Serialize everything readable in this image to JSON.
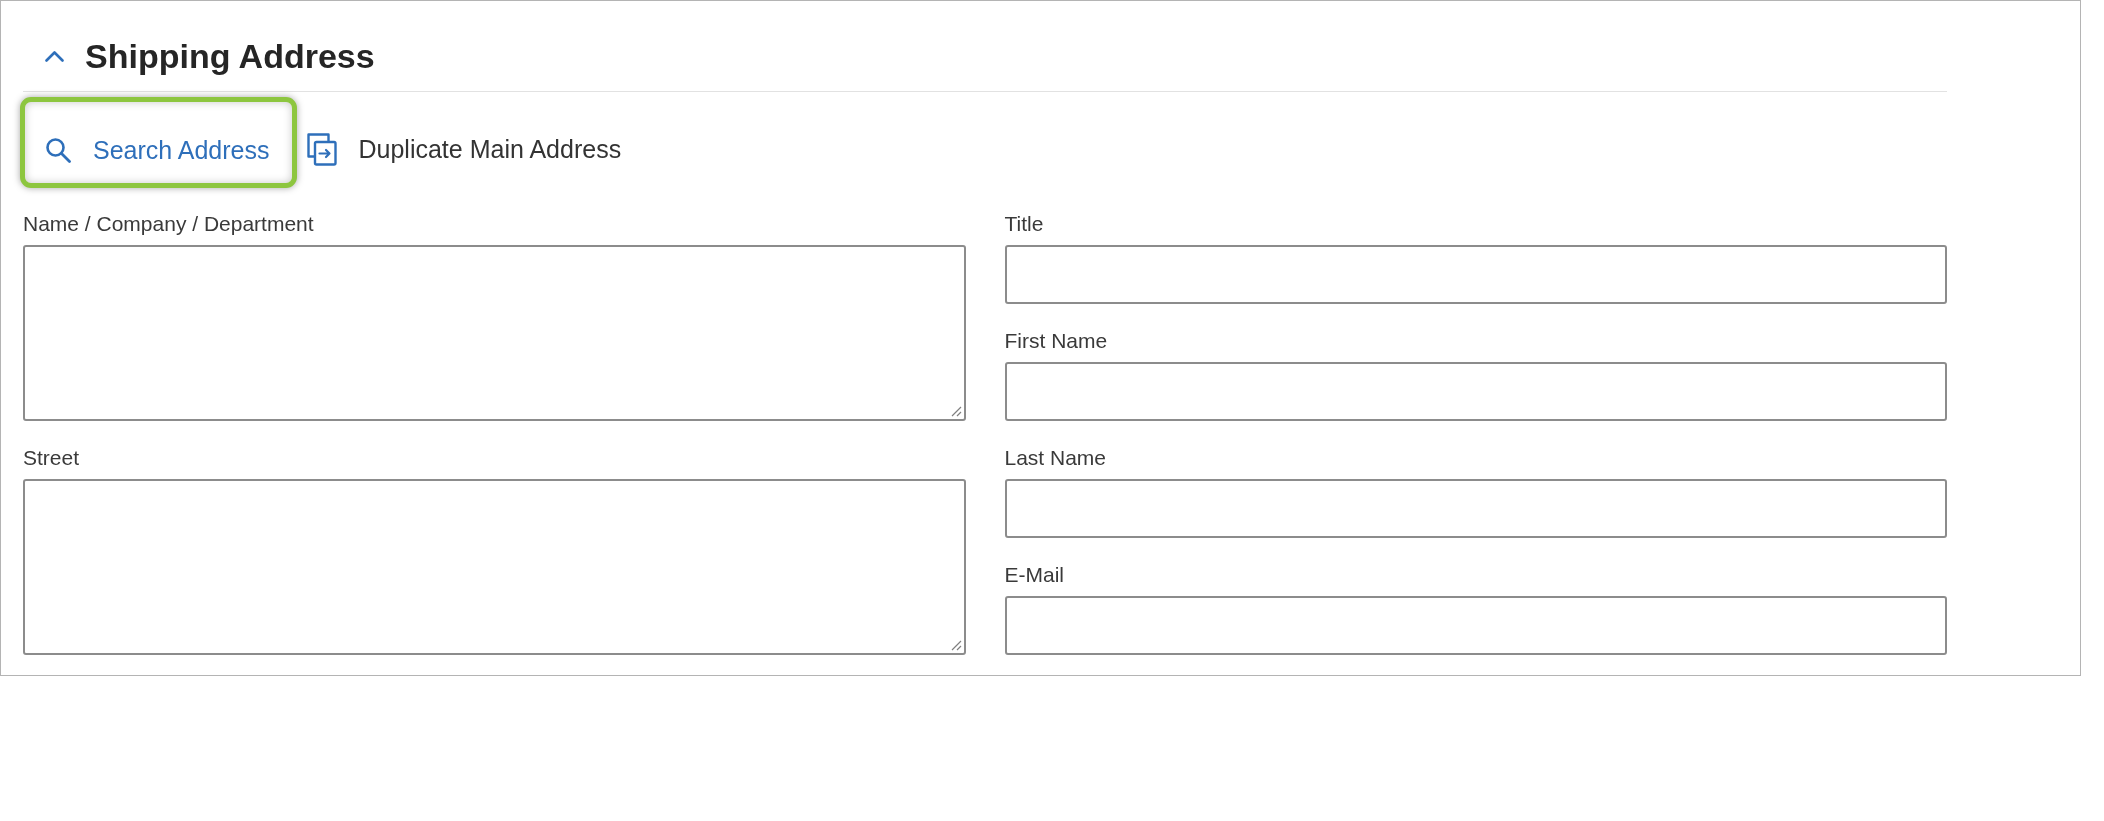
{
  "section": {
    "title": "Shipping Address",
    "expanded": true
  },
  "actions": [
    {
      "label": "Search Address",
      "kind": "search",
      "highlighted": true
    },
    {
      "label": "Duplicate Main Address",
      "kind": "duplicate",
      "highlighted": false
    }
  ],
  "left_fields": [
    {
      "label": "Name / Company / Department",
      "kind": "textarea"
    },
    {
      "label": "Street",
      "kind": "textarea"
    }
  ],
  "right_fields": [
    {
      "label": "Title",
      "kind": "input"
    },
    {
      "label": "First Name",
      "kind": "input"
    },
    {
      "label": "Last Name",
      "kind": "input"
    },
    {
      "label": "E-Mail",
      "kind": "input"
    }
  ]
}
